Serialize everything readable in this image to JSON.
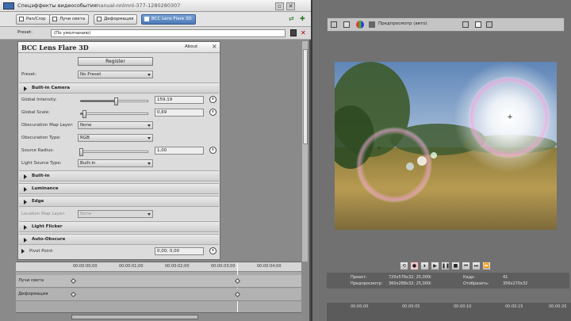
{
  "dialog": {
    "title": "Спецэффекты видеособытия:",
    "subtitle": "manual-nnlmnl-377-1280280307",
    "chain": [
      "Pan/Crop",
      "Лучи света",
      "Деформация",
      "BCC Lens Flare 3D"
    ],
    "preset_label": "Preset:",
    "preset_value": "(По умолчанию)"
  },
  "panel": {
    "name": "BCC Lens Flare 3D",
    "about": "About",
    "register": "Register",
    "preset_label": "Preset:",
    "preset_value": "No Preset",
    "sections": {
      "built_in_camera": "Built-in Camera",
      "built_in": "Built-in",
      "luminance": "Luminance",
      "edge": "Edge",
      "light_flicker": "Light Flicker",
      "auto_obscure": "Auto-Obscure"
    },
    "global_intensity": {
      "label": "Global Intensity:",
      "value": "159.19",
      "level": 0.52
    },
    "global_scale": {
      "label": "Global Scale:",
      "value": "0,69",
      "level": 0.05
    },
    "obscuration_map_layer": {
      "label": "Obscuration Map Layer:",
      "value": "None"
    },
    "obscuration_type": {
      "label": "Obscuration Type:",
      "value": "RGB"
    },
    "source_radius": {
      "label": "Source Radius:",
      "value": "1,00",
      "level": 0.0
    },
    "light_source_type": {
      "label": "Light Source Type:",
      "value": "Built-in"
    },
    "location_map_layer": {
      "label": "Location Map Layer:",
      "value": "None"
    },
    "pivot_point": {
      "label": "Pivot Point:",
      "value": "0,00; 0,00"
    }
  },
  "timeline": {
    "ticks": [
      "00:00:00;00",
      "00:00:01;00",
      "00:00:02;00",
      "00:00:03;00",
      "00:00:04;00"
    ],
    "tracks": [
      "Лучи света",
      "Деформация"
    ]
  },
  "preview": {
    "toolbar_label": "Предпросмотр (авто)",
    "info": {
      "project_label": "Проект:",
      "project_value": "720x576x32; 25,000i",
      "preview_label": "Предпросмотр:",
      "preview_value": "360x288x32; 25,000i",
      "frame_label": "Кадр:",
      "frame_value": "41",
      "display_label": "Отобразить:",
      "display_value": "356x270x32"
    },
    "ruler": [
      "00:00:00",
      "00:00:05",
      "00:00:10",
      "00:00:15",
      "00:00:20"
    ]
  }
}
